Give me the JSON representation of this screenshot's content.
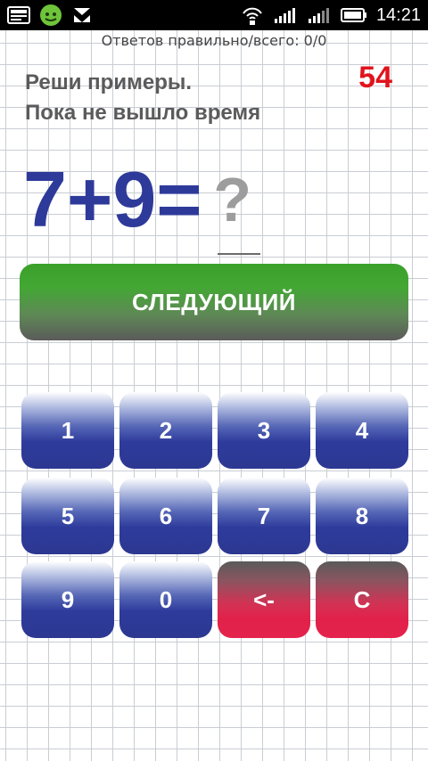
{
  "status_bar": {
    "time": "14:21",
    "left_icons": [
      "screenshot-icon",
      "android-icon",
      "launcher-icon"
    ],
    "right_icons": [
      "hotspot-icon",
      "signal-icon",
      "signal-icon-2",
      "battery-icon"
    ]
  },
  "header": {
    "score_text": "Ответов правильно/всего: 0/0"
  },
  "instruction": {
    "line1": "Реши примеры.",
    "line2": "Пока не вышло время"
  },
  "timer": {
    "value": "54"
  },
  "equation": {
    "expression": "7+9=",
    "answer_placeholder": "?"
  },
  "next_button": {
    "label": "СЛЕДУЮЩИЙ"
  },
  "keypad": {
    "keys": [
      "1",
      "2",
      "3",
      "4",
      "5",
      "6",
      "7",
      "8",
      "9",
      "0",
      "<-",
      "C"
    ]
  },
  "colors": {
    "accent_blue": "#2e3a9a",
    "timer_red": "#e0141e",
    "button_green": "#3aa02a",
    "key_red": "#e2214a"
  }
}
